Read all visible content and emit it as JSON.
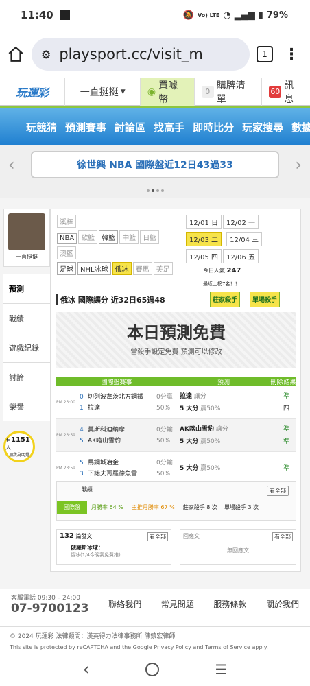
{
  "status": {
    "time": "11:40",
    "battery": "79%",
    "lte": "Vo) LTE"
  },
  "browser": {
    "url": "playsport.cc/visit_m",
    "tabs": "1"
  },
  "nav1": {
    "logo": "玩運彩",
    "menu": "一直挺挺",
    "coin": "買噱幣",
    "cart_count": "0",
    "cart": "購牌清單",
    "msg_count": "60",
    "msg": "訊息"
  },
  "nav2": [
    "玩競猜",
    "預測賽事",
    "討論區",
    "找高手",
    "即時比分",
    "玩家搜尋",
    "數據"
  ],
  "banner": {
    "text": "徐世興 NBA 國際盤近12日43過33"
  },
  "side": {
    "name": "一直挺挺",
    "items": [
      "預測",
      "戰績",
      "遊戲紀錄",
      "討論",
      "榮譽"
    ],
    "count_prefix": "有",
    "count": "1151",
    "count_suffix": "人",
    "count_note": "加我為明燈"
  },
  "leagues": {
    "row1": [
      "溪棒"
    ],
    "row2": [
      "NBA",
      "歐籃",
      "韓籃",
      "中籃",
      "日籃"
    ],
    "row3": [
      "澳籃"
    ],
    "row4": [
      "足球",
      "NHL冰球",
      "俄冰",
      "賽馬",
      "美足"
    ]
  },
  "dates": [
    "12/01 日",
    "12/02 一",
    "12/03 二",
    "12/04 三",
    "12/05 四",
    "12/06 五"
  ],
  "stats": {
    "visits_label": "今日人氣",
    "visits": "247",
    "rank": "最近上榜7名！！",
    "tag1": "莊家殺手",
    "tag2": "單場殺手"
  },
  "record": {
    "title": "俄冰 國際讓分",
    "detail": "近32日65過48"
  },
  "free": {
    "title": "本日預測免費",
    "sub": "當殺手設定免費  預測可以修改"
  },
  "table": {
    "h1": "國際盤賽事",
    "h2": "預測",
    "h3": "刪除",
    "h4": "結果",
    "rows": [
      {
        "time": "PM 23:00",
        "n1": "0",
        "n2": "1",
        "t1": "切列波韋茨北方鋼鐵",
        "t2": "拉達",
        "odds1": "0分贏",
        "odds2": "50%",
        "p1": "拉達",
        "p1s": "讓分",
        "p2": "5 大分",
        "p2s": "贏50%",
        "r1": "準",
        "r2": "四"
      },
      {
        "time": "PM 23:59",
        "n1": "4",
        "n2": "5",
        "t1": "莫斯科迪納摩",
        "t2": "AK喀山雪豹",
        "odds1": "0分輸",
        "odds2": "50%",
        "p1": "AK喀山雪豹",
        "p1s": "讓分",
        "p2": "5 大分",
        "p2s": "贏50%",
        "r1": "準",
        "r2": "準"
      },
      {
        "time": "PM 23:59",
        "n1": "5",
        "n2": "3",
        "t1": "馬鋼城冶金",
        "t2": "下諾夫哥羅德魚雷",
        "odds1": "0分輸",
        "odds2": "50%",
        "p1": "",
        "p1s": "",
        "p2": "5 大分",
        "p2s": "贏50%",
        "r1": "準",
        "r2": ""
      }
    ]
  },
  "summary": {
    "title": "戰績",
    "btn": "看全部",
    "c1": "國際盤",
    "c2": "月勝率 64 %",
    "c3": "主推月勝率 67 %",
    "c4": "莊家殺手 8 次",
    "c5": "單場殺手 3 次"
  },
  "posts": {
    "count": "132",
    "label": "篇發文",
    "btn": "看全部",
    "item": "俄羅斯冰球：",
    "sub": "俄冰(1/4今晚我免費推)",
    "reply": "1",
    "right": "回應文",
    "empty": "無回應文"
  },
  "footer": {
    "phone_label": "客服電話 09:30 – 24:00",
    "phone": "07-9700123",
    "links": [
      "聯絡我們",
      "常見問題",
      "服務條款",
      "關於我們"
    ],
    "copy": "© 2024 玩運彩 法律顧問：漢英得力法律事務所 陳鎮宏律師",
    "recaptcha": "This site is protected by reCAPTCHA and the Google Privacy Policy and Terms of Service apply."
  }
}
